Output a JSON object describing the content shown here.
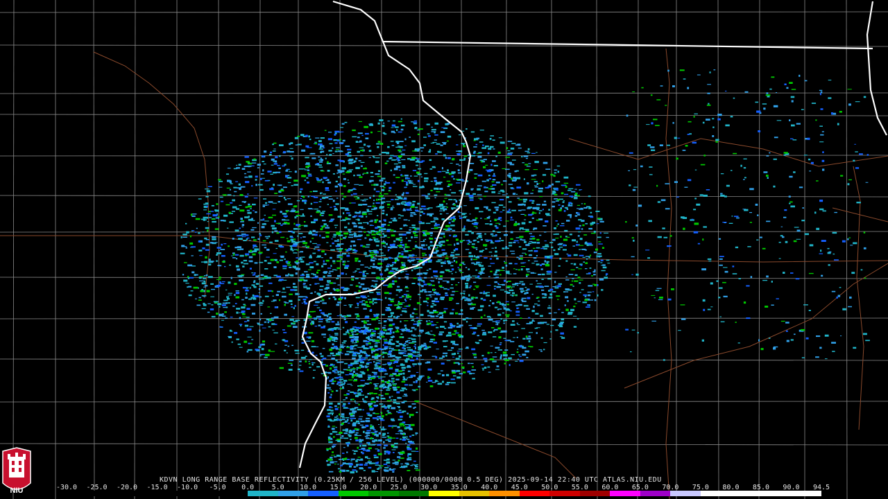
{
  "product": {
    "header": "KDVN LONG RANGE BASE REFLECTIVITY (0.25KM / 256 LEVEL) (000000/0000 0.5 DEG) 2025-09-14 22:40 UTC  ATLAS.NIU.EDU"
  },
  "logo": {
    "text": "NIU",
    "icon": "niu-tower-logo-icon",
    "color": "#c8102e"
  },
  "radar_site": {
    "id": "KDVN"
  },
  "colorbar": {
    "labels": [
      "-30.0",
      "-25.0",
      "-20.0",
      "-15.0",
      "-10.0",
      "-5.0",
      "0.0",
      "5.0",
      "10.0",
      "15.0",
      "20.0",
      "25.0",
      "30.0",
      "35.0",
      "40.0",
      "45.0",
      "50.0",
      "55.0",
      "60.0",
      "65.0",
      "70.0",
      "75.0",
      "80.0",
      "85.0",
      "90.0",
      "94.5"
    ],
    "colors": [
      "#000000",
      "#000000",
      "#000000",
      "#000000",
      "#000000",
      "#000000",
      "#20b4c8",
      "#30a0e8",
      "#1460ff",
      "#00c800",
      "#009600",
      "#007800",
      "#ffff00",
      "#e6c000",
      "#ff9000",
      "#ff0000",
      "#d00000",
      "#a00000",
      "#ff00ff",
      "#9e00c8",
      "#c8c8ff",
      "#ffffff",
      "#ffffff",
      "#ffffff",
      "#ffffff"
    ]
  },
  "style": {
    "county_color": "#8c8c8c",
    "state_color": "#ffffff",
    "road_color": "#8b4a2c"
  }
}
